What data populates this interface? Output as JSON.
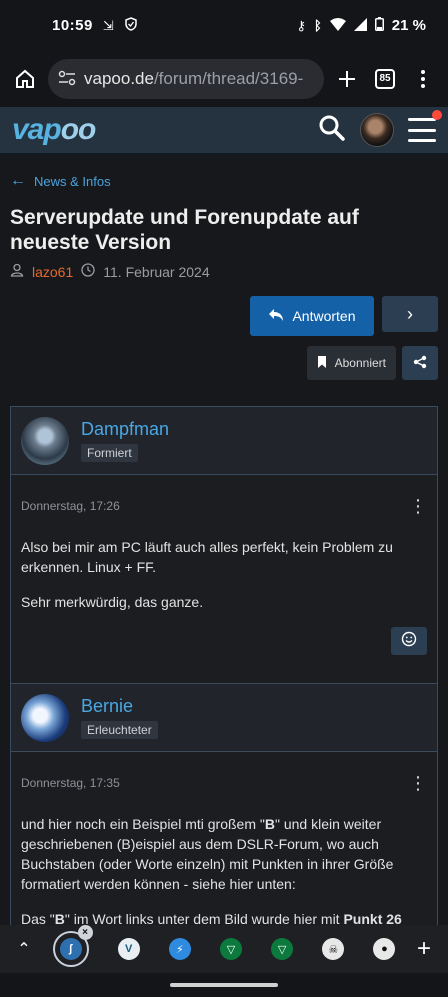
{
  "status_bar": {
    "time": "10:59",
    "battery": "21 %"
  },
  "browser": {
    "url_host": "vapoo.de",
    "url_path": "/forum/thread/3169-",
    "tab_count": "85"
  },
  "site": {
    "logo_prefix": "vap",
    "logo_suffix": "oo"
  },
  "breadcrumb": {
    "label": "News & Infos"
  },
  "thread": {
    "title": "Serverupdate und Forenupdate auf neueste Version",
    "author": "lazo61",
    "date": "11. Februar 2024"
  },
  "actions": {
    "reply_label": "Antworten",
    "subscribed_label": "Abonniert"
  },
  "posts": [
    {
      "username": "Dampfman",
      "rank": "Formiert",
      "timestamp": "Donnerstag, 17:26",
      "paragraphs": [
        "Also bei mir am PC läuft auch alles perfekt, kein Problem zu erkennen. Linux + FF.",
        "Sehr merkwürdig, das ganze."
      ]
    },
    {
      "username": "Bernie",
      "rank": "Erleuchteter",
      "timestamp": "Donnerstag, 17:35",
      "p1_pre": "und hier noch ein Beispiel mti großem \"",
      "p1_b1": "B",
      "p1_mid": "\" und klein weiter geschriebenen (B)eispiel aus dem DSLR-Forum, wo auch Buchstaben (oder Worte einzeln) mit Punkten in ihrer Größe formatiert werden können - siehe hier unten:",
      "p2_pre": "Das \"",
      "p2_b1": "B",
      "p2_mid": "\" im Wort links unter dem Bild wurde hier mit ",
      "p2_b2": "Punkt 26"
    }
  ],
  "colors": {
    "header_bg": "#253341",
    "accent_blue": "#1461a8",
    "link_blue": "#48a7e4",
    "author_orange": "#e46a2e",
    "notification_red": "#ff4a3c"
  }
}
